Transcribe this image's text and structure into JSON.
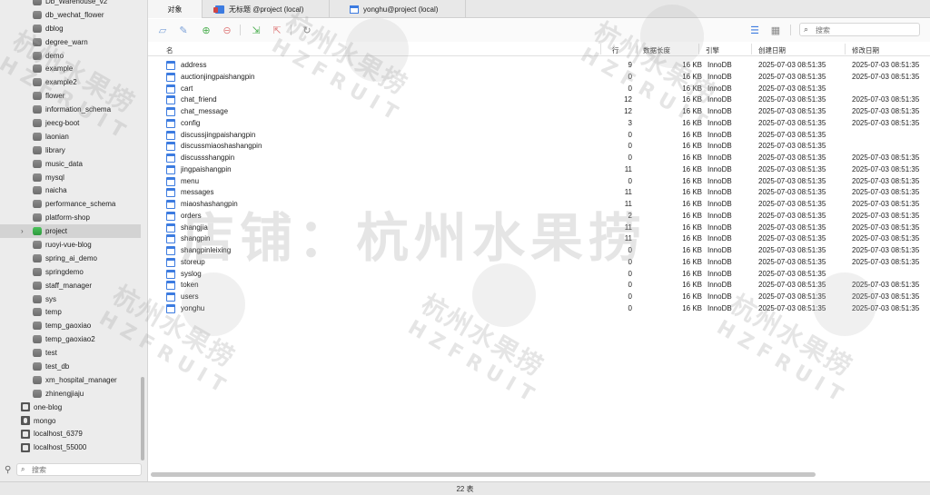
{
  "sidebar": {
    "items": [
      {
        "label": "Db_Warehouse_v2",
        "type": "db"
      },
      {
        "label": "db_wechat_flower",
        "type": "db"
      },
      {
        "label": "dblog",
        "type": "db"
      },
      {
        "label": "degree_warn",
        "type": "db"
      },
      {
        "label": "demo",
        "type": "db"
      },
      {
        "label": "example",
        "type": "db"
      },
      {
        "label": "example2",
        "type": "db"
      },
      {
        "label": "flower",
        "type": "db"
      },
      {
        "label": "information_schema",
        "type": "db"
      },
      {
        "label": "jeecg-boot",
        "type": "db"
      },
      {
        "label": "laonian",
        "type": "db"
      },
      {
        "label": "library",
        "type": "db"
      },
      {
        "label": "music_data",
        "type": "db"
      },
      {
        "label": "mysql",
        "type": "db"
      },
      {
        "label": "naicha",
        "type": "db"
      },
      {
        "label": "performance_schema",
        "type": "db"
      },
      {
        "label": "platform-shop",
        "type": "db"
      },
      {
        "label": "project",
        "type": "db-active"
      },
      {
        "label": "ruoyi-vue-blog",
        "type": "db"
      },
      {
        "label": "spring_ai_demo",
        "type": "db"
      },
      {
        "label": "springdemo",
        "type": "db"
      },
      {
        "label": "staff_manager",
        "type": "db"
      },
      {
        "label": "sys",
        "type": "db"
      },
      {
        "label": "temp",
        "type": "db"
      },
      {
        "label": "temp_gaoxiao",
        "type": "db"
      },
      {
        "label": "temp_gaoxiao2",
        "type": "db"
      },
      {
        "label": "test",
        "type": "db"
      },
      {
        "label": "test_db",
        "type": "db"
      },
      {
        "label": "xm_hospital_manager",
        "type": "db"
      },
      {
        "label": "zhinengjiaju",
        "type": "db"
      },
      {
        "label": "one-blog",
        "type": "conn"
      },
      {
        "label": "mongo",
        "type": "mongo"
      },
      {
        "label": "localhost_6379",
        "type": "conn"
      },
      {
        "label": "localhost_55000",
        "type": "conn"
      }
    ],
    "search_placeholder": "搜索",
    "chevron": "›"
  },
  "tabs": [
    {
      "label": "对象",
      "icon": "none",
      "active": true
    },
    {
      "label": "无标题 @project (local)",
      "icon": "query-icon",
      "active": false
    },
    {
      "label": "yonghu@project (local)",
      "icon": "table-icon",
      "active": false
    }
  ],
  "toolbar": {
    "search_placeholder": "搜索"
  },
  "table": {
    "headers": {
      "name": "名",
      "rows": "行",
      "size": "数据长度",
      "engine": "引擎",
      "created": "创建日期",
      "modified": "修改日期"
    },
    "rows": [
      {
        "name": "address",
        "rows": "9",
        "size": "16 KB",
        "engine": "InnoDB",
        "created": "2025-07-03 08:51:35",
        "modified": "2025-07-03 08:51:35"
      },
      {
        "name": "auctionjingpaishangpin",
        "rows": "0",
        "size": "16 KB",
        "engine": "InnoDB",
        "created": "2025-07-03 08:51:35",
        "modified": "2025-07-03 08:51:35"
      },
      {
        "name": "cart",
        "rows": "0",
        "size": "16 KB",
        "engine": "InnoDB",
        "created": "2025-07-03 08:51:35",
        "modified": ""
      },
      {
        "name": "chat_friend",
        "rows": "12",
        "size": "16 KB",
        "engine": "InnoDB",
        "created": "2025-07-03 08:51:35",
        "modified": "2025-07-03 08:51:35"
      },
      {
        "name": "chat_message",
        "rows": "12",
        "size": "16 KB",
        "engine": "InnoDB",
        "created": "2025-07-03 08:51:35",
        "modified": "2025-07-03 08:51:35"
      },
      {
        "name": "config",
        "rows": "3",
        "size": "16 KB",
        "engine": "InnoDB",
        "created": "2025-07-03 08:51:35",
        "modified": "2025-07-03 08:51:35"
      },
      {
        "name": "discussjingpaishangpin",
        "rows": "0",
        "size": "16 KB",
        "engine": "InnoDB",
        "created": "2025-07-03 08:51:35",
        "modified": ""
      },
      {
        "name": "discussmiaoshashangpin",
        "rows": "0",
        "size": "16 KB",
        "engine": "InnoDB",
        "created": "2025-07-03 08:51:35",
        "modified": ""
      },
      {
        "name": "discussshangpin",
        "rows": "0",
        "size": "16 KB",
        "engine": "InnoDB",
        "created": "2025-07-03 08:51:35",
        "modified": "2025-07-03 08:51:35"
      },
      {
        "name": "jingpaishangpin",
        "rows": "11",
        "size": "16 KB",
        "engine": "InnoDB",
        "created": "2025-07-03 08:51:35",
        "modified": "2025-07-03 08:51:35"
      },
      {
        "name": "menu",
        "rows": "0",
        "size": "16 KB",
        "engine": "InnoDB",
        "created": "2025-07-03 08:51:35",
        "modified": "2025-07-03 08:51:35"
      },
      {
        "name": "messages",
        "rows": "11",
        "size": "16 KB",
        "engine": "InnoDB",
        "created": "2025-07-03 08:51:35",
        "modified": "2025-07-03 08:51:35"
      },
      {
        "name": "miaoshashangpin",
        "rows": "11",
        "size": "16 KB",
        "engine": "InnoDB",
        "created": "2025-07-03 08:51:35",
        "modified": "2025-07-03 08:51:35"
      },
      {
        "name": "orders",
        "rows": "2",
        "size": "16 KB",
        "engine": "InnoDB",
        "created": "2025-07-03 08:51:35",
        "modified": "2025-07-03 08:51:35"
      },
      {
        "name": "shangjia",
        "rows": "11",
        "size": "16 KB",
        "engine": "InnoDB",
        "created": "2025-07-03 08:51:35",
        "modified": "2025-07-03 08:51:35"
      },
      {
        "name": "shangpin",
        "rows": "11",
        "size": "16 KB",
        "engine": "InnoDB",
        "created": "2025-07-03 08:51:35",
        "modified": "2025-07-03 08:51:35"
      },
      {
        "name": "shangpinleixing",
        "rows": "0",
        "size": "16 KB",
        "engine": "InnoDB",
        "created": "2025-07-03 08:51:35",
        "modified": "2025-07-03 08:51:35"
      },
      {
        "name": "storeup",
        "rows": "0",
        "size": "16 KB",
        "engine": "InnoDB",
        "created": "2025-07-03 08:51:35",
        "modified": "2025-07-03 08:51:35"
      },
      {
        "name": "syslog",
        "rows": "0",
        "size": "16 KB",
        "engine": "InnoDB",
        "created": "2025-07-03 08:51:35",
        "modified": ""
      },
      {
        "name": "token",
        "rows": "0",
        "size": "16 KB",
        "engine": "InnoDB",
        "created": "2025-07-03 08:51:35",
        "modified": "2025-07-03 08:51:35"
      },
      {
        "name": "users",
        "rows": "0",
        "size": "16 KB",
        "engine": "InnoDB",
        "created": "2025-07-03 08:51:35",
        "modified": "2025-07-03 08:51:35"
      },
      {
        "name": "yonghu",
        "rows": "0",
        "size": "16 KB",
        "engine": "InnoDB",
        "created": "2025-07-03 08:51:35",
        "modified": "2025-07-03 08:51:35"
      }
    ]
  },
  "status": {
    "text": "22 表"
  },
  "watermark": {
    "main": "店铺：杭州水果捞",
    "small": "杭州水果捞",
    "en": "HZFRUIT"
  },
  "colors": {
    "accent": "#3c7be0",
    "active_db": "#2e9a3d"
  }
}
